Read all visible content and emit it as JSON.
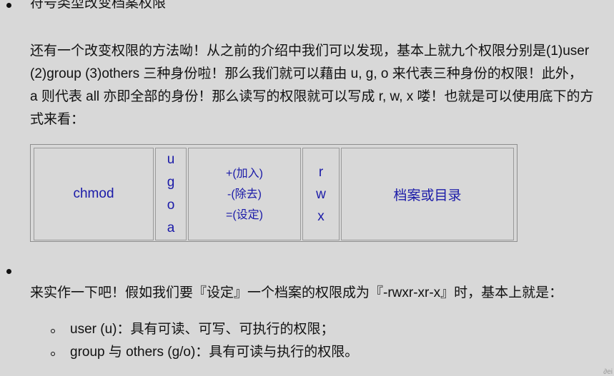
{
  "section1": {
    "heading": "符号类型改变档案权限",
    "paragraph_lines": [
      "还有一个改变权限的方法呦！从之前的介绍中我们可以发现，基本上就九个权限分别是(1)user",
      "(2)group (3)others 三种身份啦！那么我们就可以藉由 u, g, o 来代表三种身份的权限！此外，",
      "a 则代表 all 亦即全部的身份！那么读写的权限就可以写成 r, w, x 喽！也就是可以使用底下的方",
      "式来看："
    ]
  },
  "table": {
    "command": "chmod",
    "who": [
      "u",
      "g",
      "o",
      "a"
    ],
    "operators": [
      "+(加入)",
      "-(除去)",
      "=(设定)"
    ],
    "permissions": [
      "r",
      "w",
      "x"
    ],
    "target": "档案或目录"
  },
  "section2": {
    "paragraph": "来实作一下吧！假如我们要『设定』一个档案的权限成为『-rwxr-xr-x』时，基本上就是：",
    "sub_items": [
      "user (u)：具有可读、可写、可执行的权限；",
      "group 与 others (g/o)：具有可读与执行的权限。"
    ]
  },
  "colors": {
    "background": "#d8d8d8",
    "table_text": "#1a1aa8",
    "body_text": "#111111"
  },
  "corner_mark": "∂ei"
}
